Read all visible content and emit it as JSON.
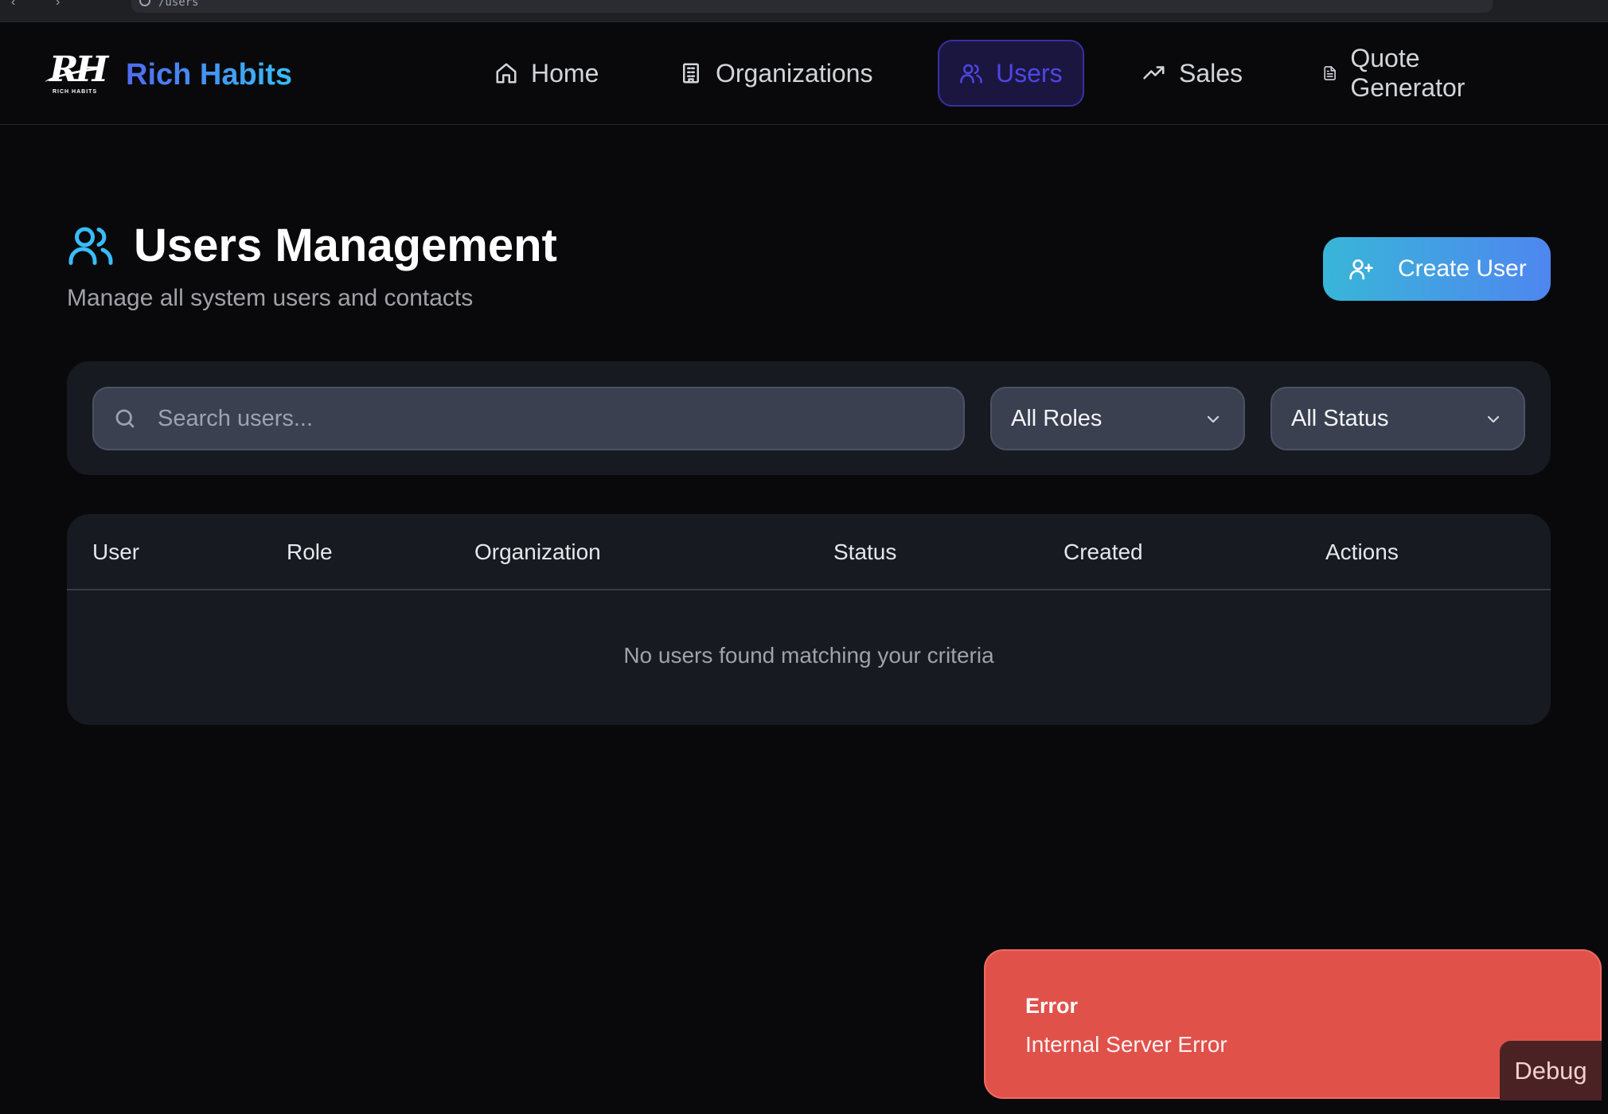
{
  "browser": {
    "url": "/users"
  },
  "brand": {
    "logo_text": "RH",
    "logo_tagline": "RICH HABITS",
    "name": "Rich Habits"
  },
  "nav": {
    "items": [
      {
        "label": "Home",
        "icon": "home-icon",
        "active": false
      },
      {
        "label": "Organizations",
        "icon": "building-icon",
        "active": false
      },
      {
        "label": "Users",
        "icon": "users-icon",
        "active": true
      },
      {
        "label": "Sales",
        "icon": "trending-up-icon",
        "active": false
      },
      {
        "label": "Quote Generator",
        "icon": "file-text-icon",
        "active": false
      }
    ]
  },
  "header": {
    "title": "Users Management",
    "subtitle": "Manage all system users and contacts",
    "create_label": "Create User"
  },
  "filters": {
    "search_placeholder": "Search users...",
    "search_value": "",
    "roles_selected": "All Roles",
    "status_selected": "All Status"
  },
  "table": {
    "columns": [
      "User",
      "Role",
      "Organization",
      "Status",
      "Created",
      "Actions"
    ],
    "rows": [],
    "empty_message": "No users found matching your criteria"
  },
  "toast": {
    "title": "Error",
    "message": "Internal Server Error",
    "debug_label": "Debug",
    "color": "#e0514a"
  },
  "colors": {
    "background": "#09090b",
    "accent_active": "#4f46e5",
    "accent_cyan": "#38bdf8",
    "panel": "#171a21"
  }
}
